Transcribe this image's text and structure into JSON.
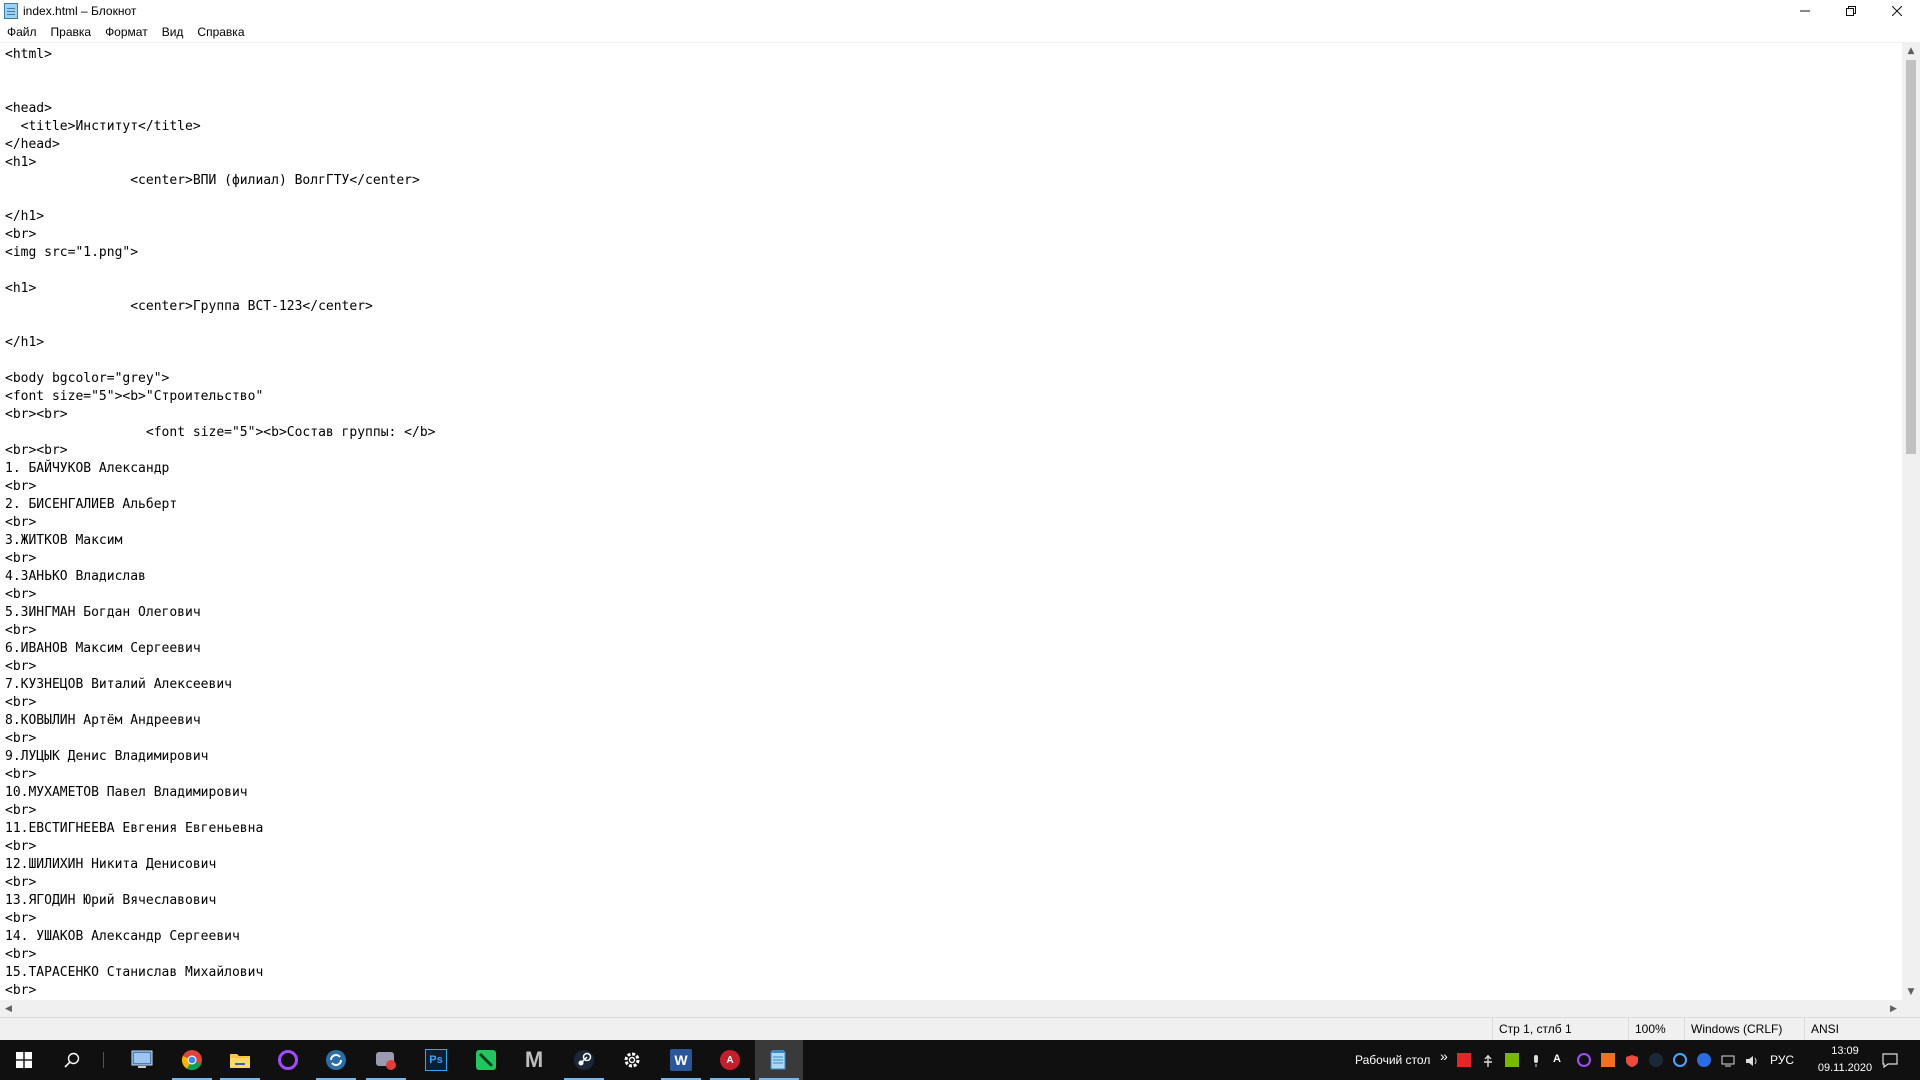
{
  "window": {
    "title": "index.html – Блокнот",
    "controls": [
      "minimize-icon",
      "restore-icon",
      "close-icon"
    ]
  },
  "menu": {
    "items": [
      "Файл",
      "Правка",
      "Формат",
      "Вид",
      "Справка"
    ]
  },
  "editor": {
    "lines": [
      "<html>",
      "",
      "",
      "<head>",
      "  <title>Институт</title>",
      "</head>",
      "<h1>",
      "\t\t<center>ВПИ (филиал) ВолгГТУ</center>",
      "",
      "</h1>",
      "<br>",
      "<img src=\"1.png\">",
      "",
      "<h1>",
      "\t\t<center>Группа ВСТ-123</center>",
      "",
      "</h1>",
      "",
      "<body bgcolor=\"grey\">",
      "<font size=\"5\"><b>\"Строительство\"",
      "<br><br>",
      "\t\t  <font size=\"5\"><b>Состав группы: </b>",
      "<br><br>",
      "1. БАЙЧУКОВ Александр",
      "<br>",
      "2. БИСЕНГАЛИЕВ Альберт",
      "<br>",
      "3.ЖИТКОВ Максим",
      "<br>",
      "4.ЗАНЬКО Владислав",
      "<br>",
      "5.ЗИНГМАН Богдан Олегович",
      "<br>",
      "6.ИВАНОВ Максим Сергеевич",
      "<br>",
      "7.КУЗНЕЦОВ Виталий Алексеевич",
      "<br>",
      "8.КОВЫЛИН Артём Андреевич",
      "<br>",
      "9.ЛУЦЫК Денис Владимирович",
      "<br>",
      "10.МУХАМЕТОВ Павел Владимирович",
      "<br>",
      "11.ЕВСТИГНЕЕВА Евгения Евгеньевна",
      "<br>",
      "12.ШИЛИХИН Никита Денисович",
      "<br>",
      "13.ЯГОДИН Юрий Вячеславович",
      "<br>",
      "14. УШАКОВ Александр Сергеевич",
      "<br>",
      "15.ТАРАСЕНКО Станислав Михайлович",
      "<br>"
    ]
  },
  "status": {
    "position": "Стр 1, стлб 1",
    "zoom": "100%",
    "line_ending": "Windows (CRLF)",
    "encoding": "ANSI"
  },
  "taskbar": {
    "apps": [
      "windows-start-icon",
      "search-icon",
      "computer-icon",
      "chrome-icon",
      "file-explorer-icon",
      "circle-app-icon",
      "sync-app-icon",
      "game-app-icon",
      "photoshop-icon",
      "phone-app-icon",
      "m-app-icon",
      "steam-icon",
      "settings-icon",
      "word-icon",
      "red-app-icon",
      "notepad-icon"
    ],
    "photoshop_label": "Ps",
    "word_label": "W",
    "m_label": "M",
    "red_label": "A",
    "desktop_label": "Рабочий стол",
    "chevron": "»",
    "language": "РУС",
    "time": "13:09",
    "date": "09.11.2020"
  },
  "colors": {
    "taskbar_bg": "#101010",
    "accent": "#76b9ed",
    "status_bg": "#f0f0f0"
  }
}
